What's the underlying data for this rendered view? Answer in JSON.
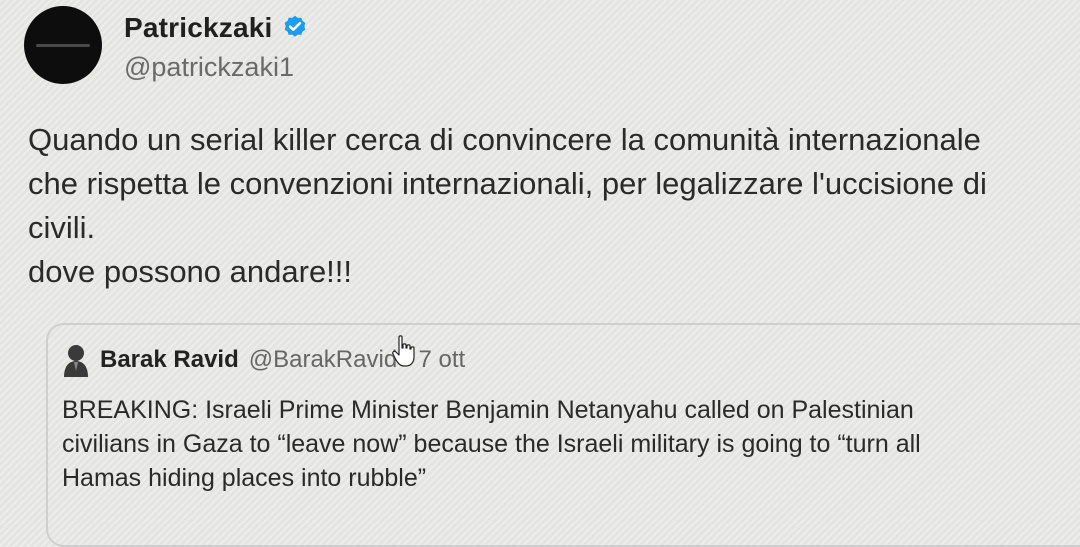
{
  "author": {
    "display_name": "Patrickzaki",
    "handle": "@patrickzaki1",
    "verified": true,
    "avatar_icon": "profile-avatar"
  },
  "tweet": {
    "lines": [
      "Quando un serial killer cerca di convincere la comunità internazionale",
      "che rispetta le convenzioni internazionali, per legalizzare l'uccisione di",
      "civili.",
      "dove possono andare!!!"
    ]
  },
  "quoted_tweet": {
    "display_name": "Barak Ravid",
    "handle_and_date": "@BarakRavid · 7 ott",
    "avatar_icon": "person-silhouette-icon",
    "lines": [
      "BREAKING: Israeli Prime Minister Benjamin Netanyahu called on Palestinian",
      "civilians in Gaza to “leave now” because the Israeli military is going to “turn all",
      "Hamas hiding places into rubble”"
    ]
  },
  "colors": {
    "verified_badge": "#1d9bf0",
    "background": "#e9e9e7"
  }
}
